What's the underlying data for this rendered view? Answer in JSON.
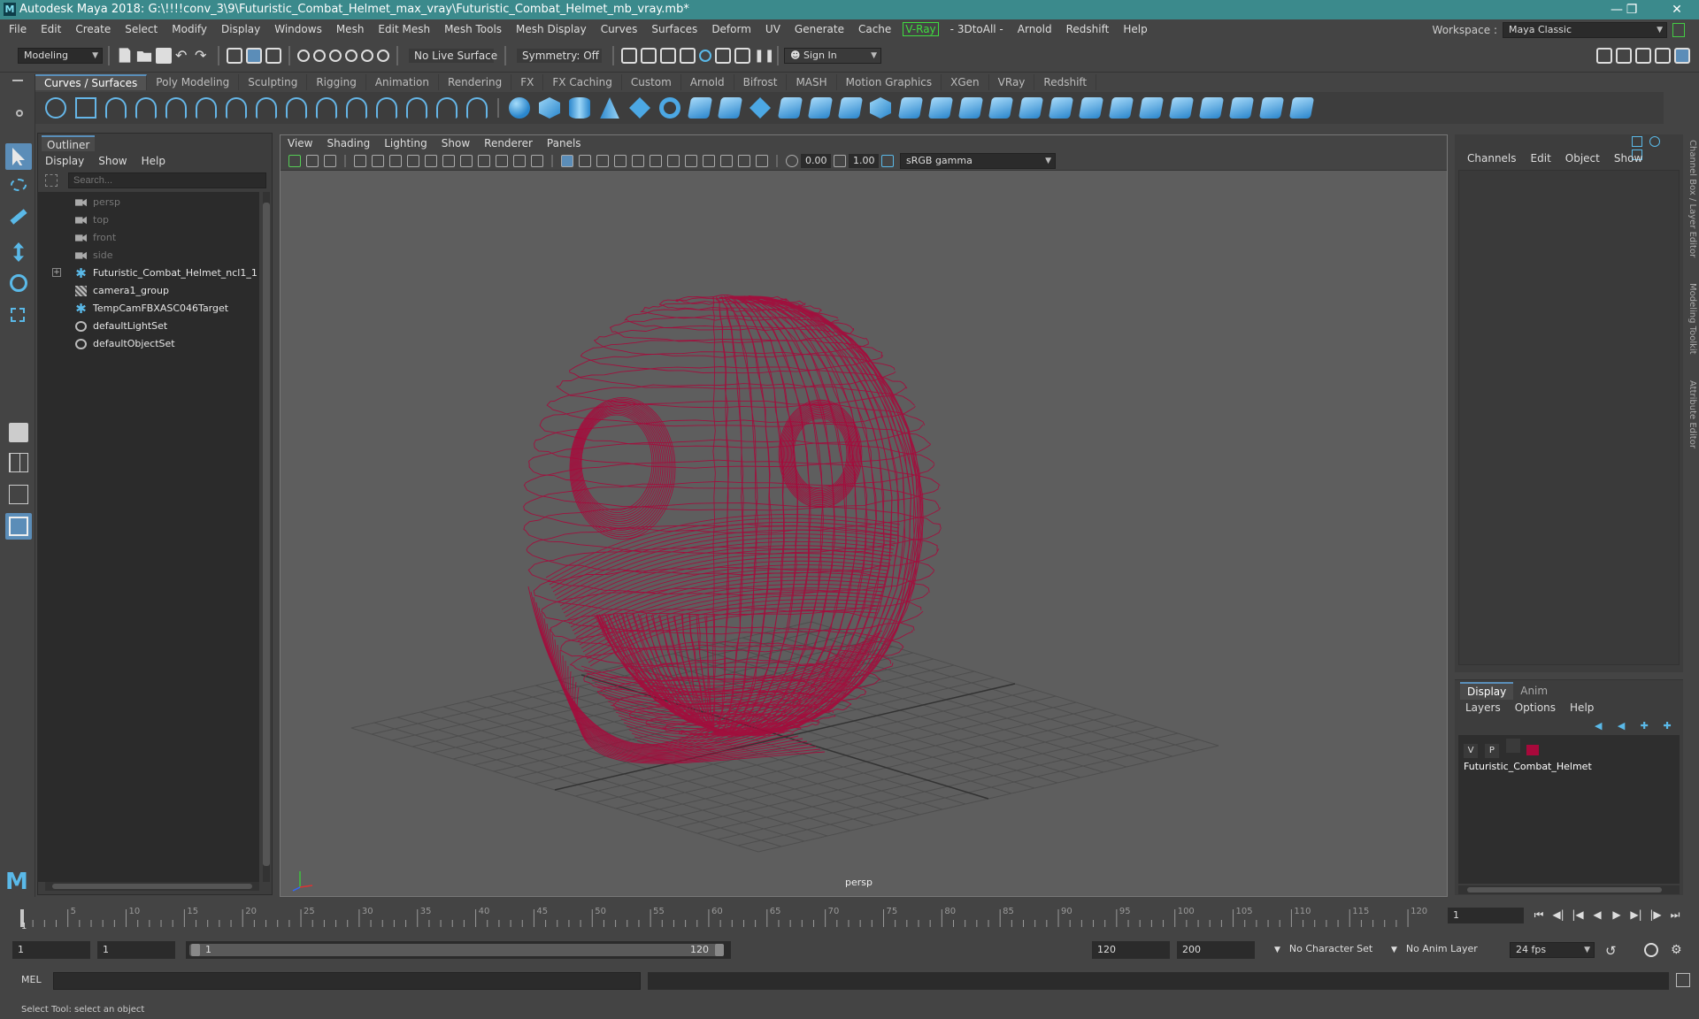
{
  "window": {
    "title": "Autodesk Maya 2018: G:\\!!!!conv_3\\9\\Futuristic_Combat_Helmet_max_vray\\Futuristic_Combat_Helmet_mb_vray.mb*",
    "logo": "M"
  },
  "menubar": {
    "items": [
      "File",
      "Edit",
      "Create",
      "Select",
      "Modify",
      "Display",
      "Windows",
      "Mesh",
      "Edit Mesh",
      "Mesh Tools",
      "Mesh Display",
      "Curves",
      "Surfaces",
      "Deform",
      "UV",
      "Generate",
      "Cache"
    ],
    "vray": "V-Ray",
    "items2": [
      "- 3DtoAll -",
      "Arnold",
      "Redshift",
      "Help"
    ]
  },
  "workspace": {
    "label": "Workspace :",
    "value": "Maya Classic"
  },
  "statusline": {
    "mode": "Modeling",
    "live_surface": "No Live Surface",
    "symmetry": "Symmetry: Off",
    "sign_in": "Sign In"
  },
  "shelf": {
    "tabs": [
      "Curves / Surfaces",
      "Poly Modeling",
      "Sculpting",
      "Rigging",
      "Animation",
      "Rendering",
      "FX",
      "FX Caching",
      "Custom",
      "Arnold",
      "Bifrost",
      "MASH",
      "Motion Graphics",
      "XGen",
      "VRay",
      "Redshift"
    ],
    "active_tab": 0
  },
  "outliner": {
    "title": "Outliner",
    "menus": [
      "Display",
      "Show",
      "Help"
    ],
    "search_placeholder": "Search...",
    "items": [
      {
        "label": "persp",
        "icon": "camera-icon",
        "dim": true
      },
      {
        "label": "top",
        "icon": "camera-icon",
        "dim": true
      },
      {
        "label": "front",
        "icon": "camera-icon",
        "dim": true
      },
      {
        "label": "side",
        "icon": "camera-icon",
        "dim": true
      },
      {
        "label": "Futuristic_Combat_Helmet_ncl1_1",
        "icon": "joint-icon",
        "dim": false,
        "expand": true
      },
      {
        "label": "camera1_group",
        "icon": "group-icon",
        "dim": false
      },
      {
        "label": "TempCamFBXASC046Target",
        "icon": "joint-icon",
        "dim": false
      },
      {
        "label": "defaultLightSet",
        "icon": "set-icon",
        "dim": false
      },
      {
        "label": "defaultObjectSet",
        "icon": "set-icon",
        "dim": false
      }
    ]
  },
  "viewport": {
    "menus": [
      "View",
      "Shading",
      "Lighting",
      "Show",
      "Renderer",
      "Panels"
    ],
    "exposure": "0.00",
    "gamma": "1.00",
    "color_space": "sRGB gamma",
    "camera_label": "persp",
    "wire_color": "#a8093b"
  },
  "channelbox": {
    "menus": [
      "Channels",
      "Edit",
      "Object",
      "Show"
    ],
    "side_tabs": [
      "Channel Box / Layer Editor",
      "Modeling Toolkit",
      "Attribute Editor"
    ]
  },
  "layereditor": {
    "tabs": [
      "Display",
      "Anim"
    ],
    "menus": [
      "Layers",
      "Options",
      "Help"
    ],
    "layer": {
      "v": "V",
      "p": "P",
      "name": "Futuristic_Combat_Helmet",
      "color": "#a8093b"
    }
  },
  "timeline": {
    "ticks": [
      "5",
      "10",
      "15",
      "20",
      "25",
      "30",
      "35",
      "40",
      "45",
      "50",
      "55",
      "60",
      "65",
      "70",
      "75",
      "80",
      "85",
      "90",
      "95",
      "100",
      "105",
      "110",
      "115",
      "120"
    ],
    "start_label": "1",
    "current_frame": "1"
  },
  "range": {
    "start": "1",
    "playback_start": "1",
    "slider_start": "1",
    "slider_end": "120",
    "playback_end": "120",
    "end": "200",
    "character_set": "No Character Set",
    "anim_layer": "No Anim Layer",
    "fps": "24 fps"
  },
  "cmdline": {
    "label": "MEL"
  },
  "helpline": {
    "text": "Select Tool: select an object"
  }
}
